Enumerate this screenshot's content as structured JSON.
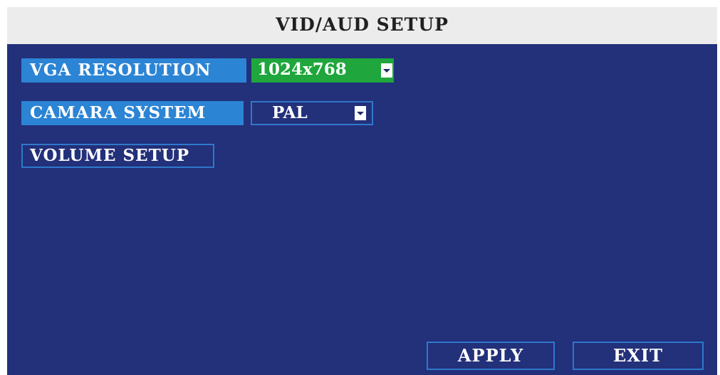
{
  "window": {
    "title": "VID/AUD SETUP"
  },
  "settings": {
    "vga_resolution": {
      "label": "VGA RESOLUTION",
      "value": "1024x768"
    },
    "camara_system": {
      "label": "CAMARA SYSTEM",
      "value": "PAL"
    },
    "volume_setup": {
      "label": "VOLUME SETUP"
    }
  },
  "buttons": {
    "apply_label": "APPLY",
    "exit_label": "EXIT"
  },
  "colors": {
    "panel_background": "#23307a",
    "label_highlight": "#2c84d4",
    "active_value": "#1fa63c",
    "outline": "#2f78cc",
    "title_bar": "#ececec"
  },
  "icons": {
    "dropdown": "chevron-down-icon"
  }
}
